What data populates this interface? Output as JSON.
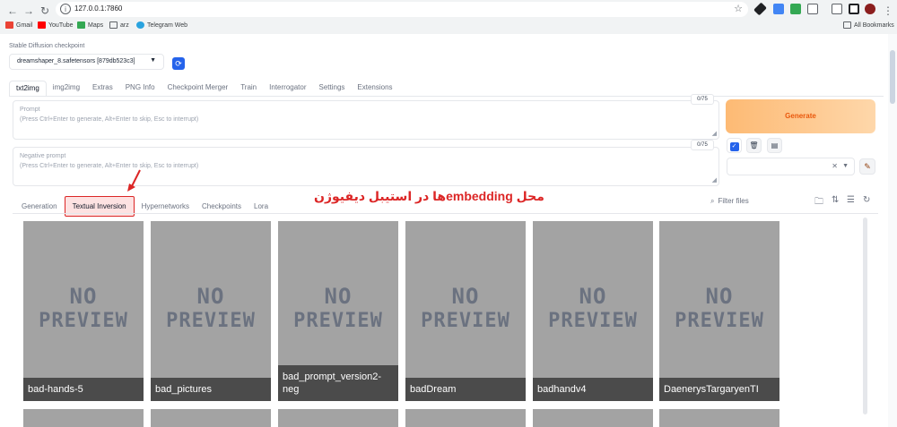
{
  "browser": {
    "url": "127.0.0.1:7860",
    "bookmarks": [
      "Gmail",
      "YouTube",
      "Maps",
      "arz",
      "Telegram Web"
    ],
    "all_bookmarks": "All Bookmarks"
  },
  "checkpoint": {
    "label": "Stable Diffusion checkpoint",
    "value": "dreamshaper_8.safetensors [879db523c3]"
  },
  "tabs": [
    "txt2img",
    "img2img",
    "Extras",
    "PNG Info",
    "Checkpoint Merger",
    "Train",
    "Interrogator",
    "Settings",
    "Extensions"
  ],
  "prompt": {
    "label": "Prompt",
    "placeholder": "(Press Ctrl+Enter to generate, Alt+Enter to skip, Esc to interrupt)",
    "token_count": "0/75"
  },
  "negative_prompt": {
    "label": "Negative prompt",
    "placeholder": "(Press Ctrl+Enter to generate, Alt+Enter to skip, Esc to interrupt)",
    "token_count": "0/75"
  },
  "generate_label": "Generate",
  "extra_tabs": [
    "Generation",
    "Textual Inversion",
    "Hypernetworks",
    "Checkpoints",
    "Lora"
  ],
  "annotation_text": "محل embeddingها در استیبل دیفیوژن",
  "filter_placeholder": "Filter files",
  "no_preview_line1": "NO",
  "no_preview_line2": "PREVIEW",
  "cards": [
    "bad-hands-5",
    "bad_pictures",
    "bad_prompt_version2-neg",
    "badDream",
    "badhandv4",
    "DaenerysTargaryenTI"
  ],
  "colors": {
    "accent": "#2563eb",
    "generate": "#fdba74",
    "annotation": "#dc2626"
  }
}
